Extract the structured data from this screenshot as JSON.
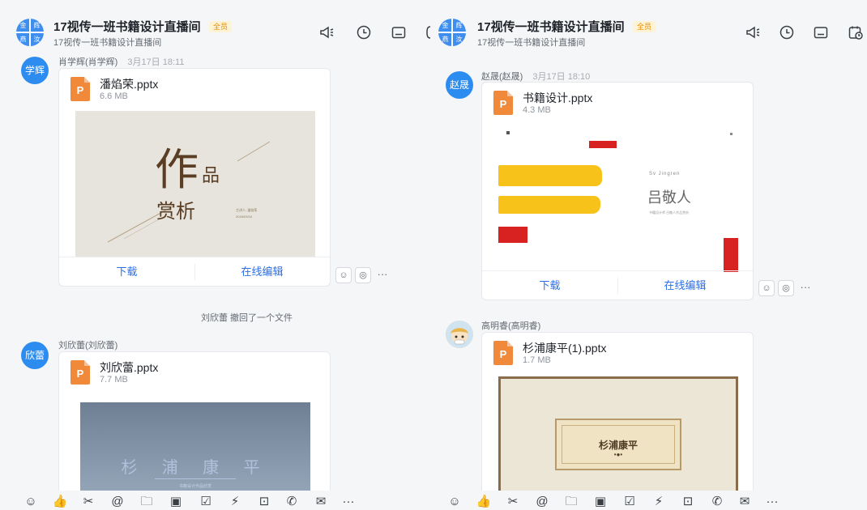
{
  "panes": [
    {
      "header": {
        "avatar_chars": [
          "金",
          "辉",
          "燕",
          "汝"
        ],
        "title": "17视传一班书籍设计直播间",
        "badge": "全员",
        "subtitle": "17视传一班书籍设计直播间",
        "icons": [
          "announcement-icon",
          "history-clock-icon",
          "folder-icon",
          "more-cut-icon"
        ]
      },
      "messages": [
        {
          "avatar": "学辉",
          "sender": "肖学辉(肖学辉)",
          "time": "3月17日 18:11",
          "file_name": "潘焰荣.pptx",
          "file_size": "6.6 MB",
          "preview": {
            "big_char": "作",
            "small_char": "品",
            "line2": "赏析",
            "small_text": "主讲人: 潘焰荣",
            "small_text2": "2018/03/16"
          },
          "download": "下载",
          "edit": "在线编辑"
        },
        {
          "avatar": "欣蕾",
          "sender": "刘欣蕾(刘欣蕾)",
          "time": "",
          "file_name": "刘欣蕾.pptx",
          "file_size": "7.7 MB",
          "preview": {
            "title": "杉 浦 康 平",
            "subtitle": "书籍设计作品欣赏"
          }
        }
      ],
      "notice": "刘欣蕾 撤回了一个文件"
    },
    {
      "header": {
        "avatar_chars": [
          "金",
          "辉",
          "燕",
          "汝"
        ],
        "title": "17视传一班书籍设计直播间",
        "badge": "全员",
        "subtitle": "17视传一班书籍设计直播间",
        "icons": [
          "announcement-icon",
          "history-clock-icon",
          "folder-icon",
          "calendar-clock-icon"
        ]
      },
      "messages": [
        {
          "avatar": "赵晟",
          "sender": "赵晟(赵晟)",
          "time": "3月17日 18:10",
          "file_name": "书籍设计.pptx",
          "file_size": "4.3 MB",
          "preview": {
            "small": "Sv  Jingren",
            "name": "吕敬人",
            "caption": "书籍设计师 吕敬人作品赏析"
          },
          "download": "下载",
          "edit": "在线编辑"
        },
        {
          "avatar": "",
          "sender": "高明睿(高明睿)",
          "time": "",
          "file_name": "杉浦康平(1).pptx",
          "file_size": "1.7 MB",
          "preview": {
            "title": "杉浦康平"
          }
        }
      ]
    }
  ],
  "toolbar": {
    "icons": [
      "emoji-icon",
      "thumbs-up-icon",
      "scissors-icon",
      "at-icon",
      "folder-send-icon",
      "calendar-icon",
      "task-check-icon",
      "lightning-icon",
      "video-icon",
      "phone-icon",
      "mail-icon",
      "more-icon"
    ],
    "more_glyph": "···"
  },
  "reactions": {
    "more": "···"
  },
  "colors": {
    "accent_blue": "#2b6fe8",
    "avatar_blue": "#2d8cf0",
    "ppt_orange": "#f08a3a",
    "badge_text": "#e58e00"
  }
}
